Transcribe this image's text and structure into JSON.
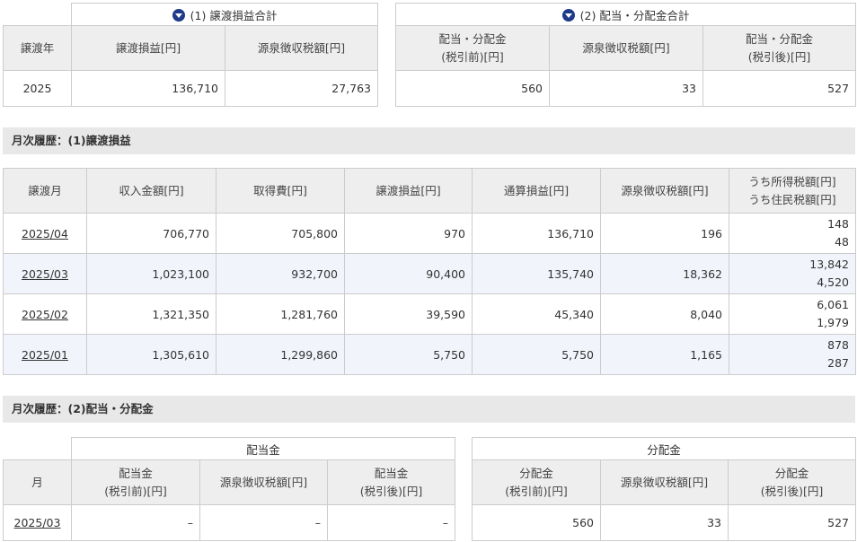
{
  "summary": {
    "transfer": {
      "title": "(1) 譲渡損益合計",
      "headers": [
        "譲渡年",
        "譲渡損益[円]",
        "源泉徴収税額[円]"
      ],
      "row": [
        "2025",
        "136,710",
        "27,763"
      ]
    },
    "dividend": {
      "title": "(2) 配当・分配金合計",
      "headers": [
        "配当・分配金",
        "(税引前)[円]",
        "源泉徴収税額[円]",
        "配当・分配金",
        "(税引後)[円]"
      ],
      "row": [
        "560",
        "33",
        "527"
      ]
    }
  },
  "monthly_transfer": {
    "section_title": "月次履歴：(1)譲渡損益",
    "headers": [
      "譲渡月",
      "収入金額[円]",
      "取得費[円]",
      "譲渡損益[円]",
      "通算損益[円]",
      "源泉徴収税額[円]",
      "うち所得税額[円]",
      "うち住民税額[円]"
    ],
    "rows": [
      {
        "month": "2025/04",
        "income": "706,770",
        "cost": "705,800",
        "gain": "970",
        "total": "136,710",
        "tax": "196",
        "income_tax": "148",
        "resident_tax": "48"
      },
      {
        "month": "2025/03",
        "income": "1,023,100",
        "cost": "932,700",
        "gain": "90,400",
        "total": "135,740",
        "tax": "18,362",
        "income_tax": "13,842",
        "resident_tax": "4,520"
      },
      {
        "month": "2025/02",
        "income": "1,321,350",
        "cost": "1,281,760",
        "gain": "39,590",
        "total": "45,340",
        "tax": "8,040",
        "income_tax": "6,061",
        "resident_tax": "1,979"
      },
      {
        "month": "2025/01",
        "income": "1,305,610",
        "cost": "1,299,860",
        "gain": "5,750",
        "total": "5,750",
        "tax": "1,165",
        "income_tax": "878",
        "resident_tax": "287"
      }
    ]
  },
  "monthly_dividend": {
    "section_title": "月次履歴：(2)配当・分配金",
    "group_dividend": "配当金",
    "group_distribution": "分配金",
    "month_header": "月",
    "headers": [
      "配当金",
      "(税引前)[円]",
      "源泉徴収税額[円]",
      "配当金",
      "(税引後)[円]",
      "分配金",
      "(税引前)[円]",
      "源泉徴収税額[円]",
      "分配金",
      "(税引後)[円]"
    ],
    "row": {
      "month": "2025/03",
      "div_pre": "–",
      "div_tax": "–",
      "div_post": "–",
      "dist_pre": "560",
      "dist_tax": "33",
      "dist_post": "527"
    }
  },
  "colors": {
    "icon": "#1e3a8a",
    "header_bg": "#eeeeee",
    "alt_row_bg": "#f1f5fb",
    "section_bg": "#e8e8e8"
  }
}
